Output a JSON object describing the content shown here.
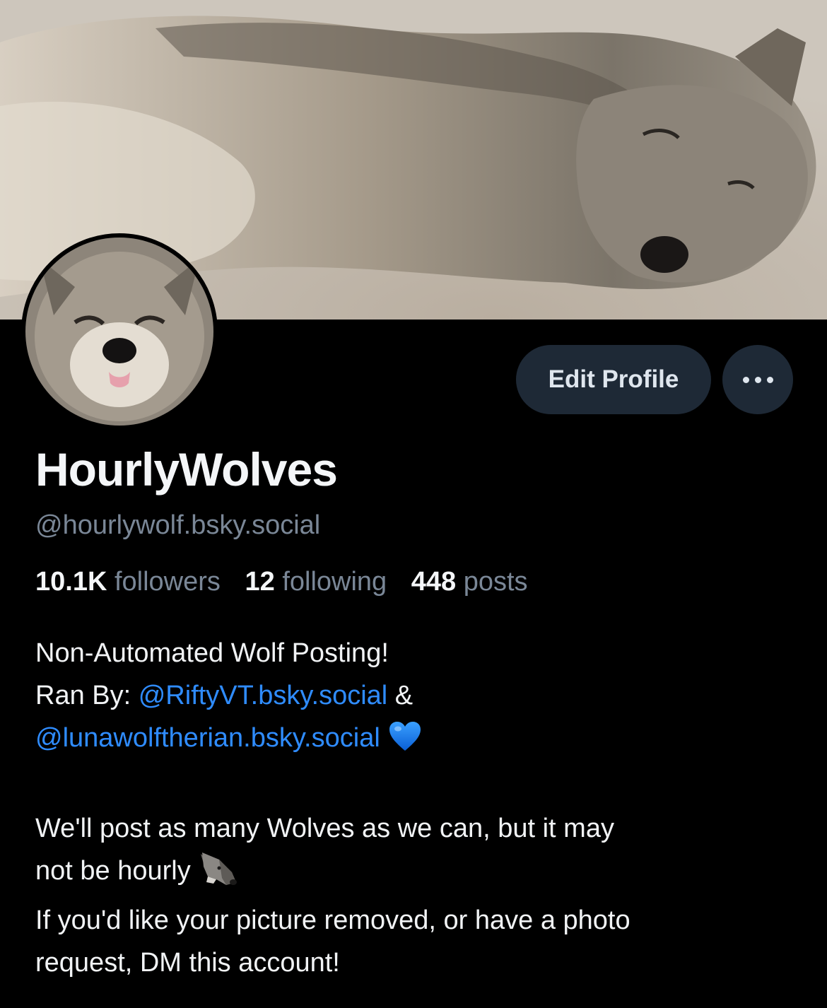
{
  "profile": {
    "display_name": "HourlyWolves",
    "handle": "@hourlywolf.bsky.social",
    "edit_button_label": "Edit Profile",
    "banner_image": "sleeping-wolf-photo",
    "avatar_image": "smiling-wolf-photo"
  },
  "stats": {
    "followers_count": "10.1K",
    "followers_label": "followers",
    "following_count": "12",
    "following_label": "following",
    "posts_count": "448",
    "posts_label": "posts"
  },
  "bio": {
    "line1": "Non-Automated Wolf Posting!",
    "ranby_prefix": "Ran By: ",
    "mention1": "@RiftyVT.bsky.social",
    "amp": " &",
    "mention2": "@lunawolftherian.bsky.social",
    "heart_icon": "blue-heart-icon",
    "line3": "We'll post as many Wolves as we can, but it may",
    "line4": "not be hourly",
    "wolf_icon": "wolf-face-icon",
    "line5": "If you'd like your picture removed, or have a photo",
    "line6": "request, DM this account!"
  },
  "colors": {
    "background": "#000000",
    "button_bg": "#1e2936",
    "muted_text": "#7a8797",
    "mention": "#2f8cff"
  }
}
